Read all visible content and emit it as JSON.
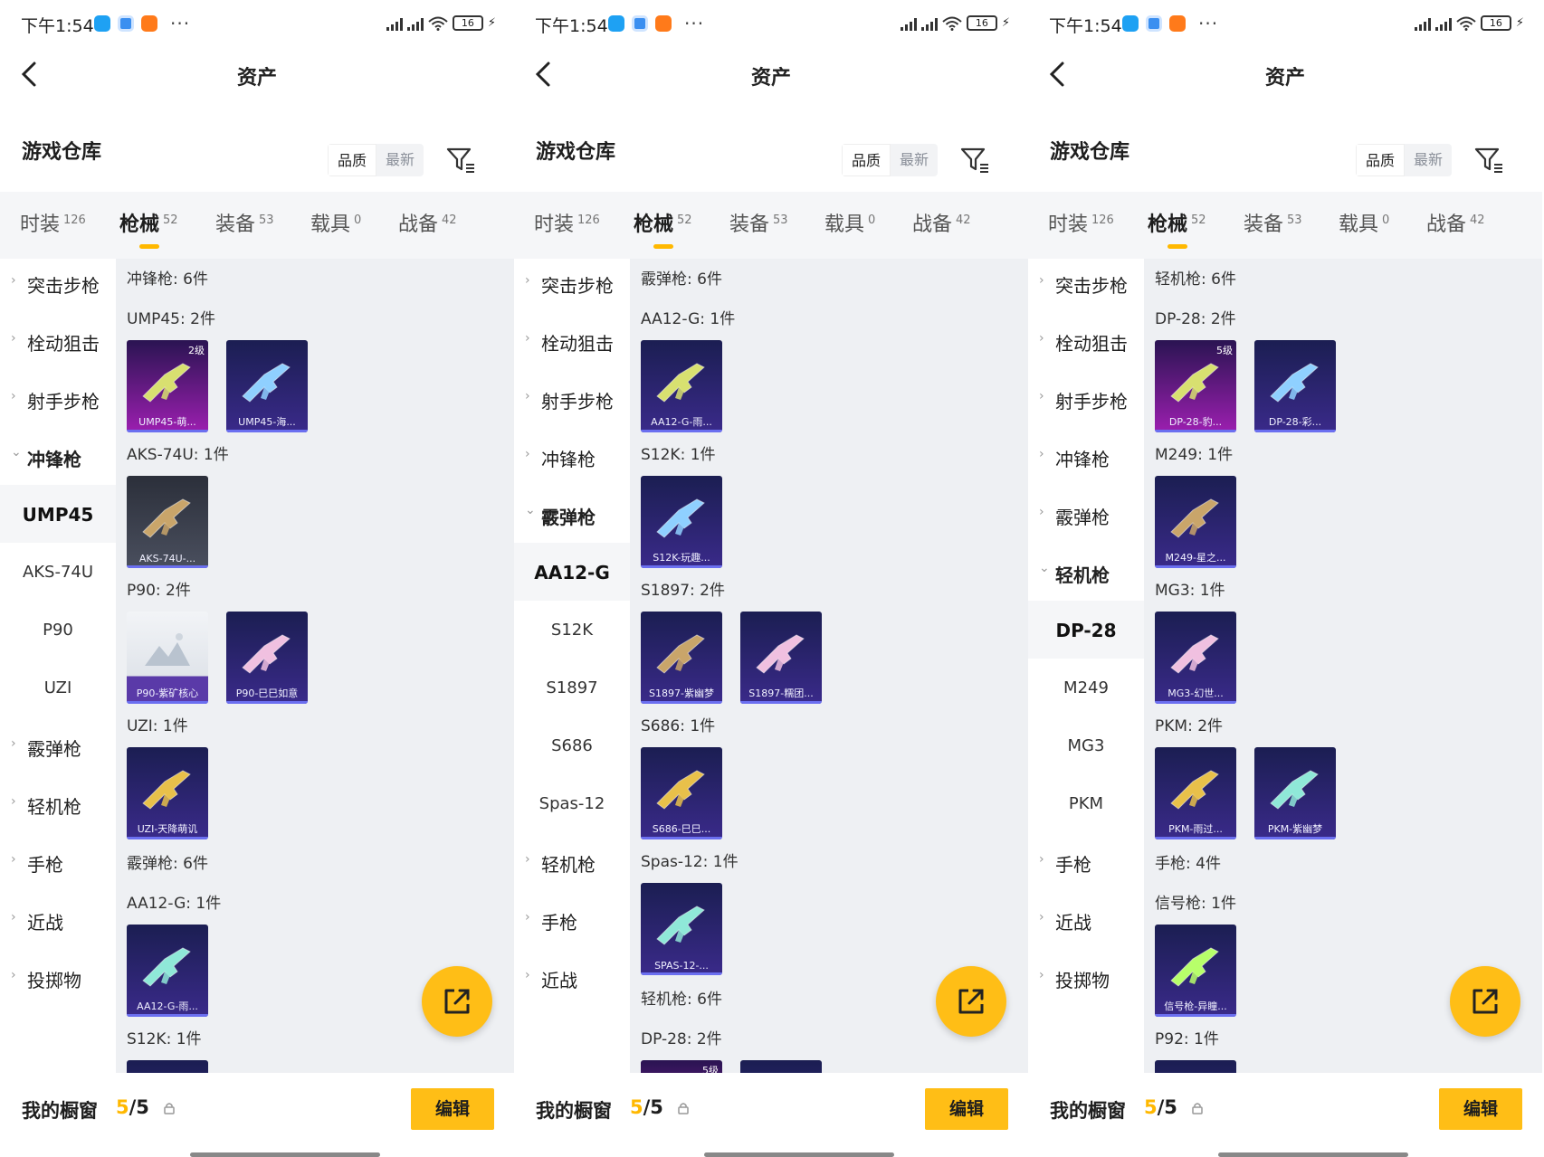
{
  "panels": [
    {
      "status": {
        "time": "下午1:54",
        "battery": "16"
      },
      "nav": {
        "title": "资产"
      },
      "header": {
        "title": "游戏仓库",
        "sort": [
          "品质",
          "最新"
        ]
      },
      "tabs": [
        {
          "label": "时装",
          "count": "126"
        },
        {
          "label": "枪械",
          "count": "52"
        },
        {
          "label": "装备",
          "count": "53"
        },
        {
          "label": "载具",
          "count": "0"
        },
        {
          "label": "战备",
          "count": "42"
        }
      ],
      "side": [
        "突击步枪",
        "栓动狙击",
        "射手步枪",
        "冲锋枪",
        "UMP45",
        "AKS-74U",
        "P90",
        "UZI",
        "霰弹枪",
        "轻机枪",
        "手枪",
        "近战",
        "投掷物"
      ],
      "content": {
        "section": "冲锋枪: 6件",
        "groups": [
          {
            "title": "UMP45: 2件",
            "items": [
              {
                "name": "UMP45-萌...",
                "level": "2级"
              },
              {
                "name": "UMP45-海...",
                "level": ""
              }
            ]
          },
          {
            "title": "AKS-74U: 1件",
            "items": [
              {
                "name": "AKS-74U-...",
                "level": ""
              }
            ]
          },
          {
            "title": "P90: 2件",
            "items": [
              {
                "name": "P90-紫矿核心",
                "level": ""
              },
              {
                "name": "P90-巳巳如意",
                "level": ""
              }
            ]
          },
          {
            "title": "UZI: 1件",
            "items": [
              {
                "name": "UZI-天降萌讥",
                "level": ""
              }
            ]
          }
        ],
        "section2": "霰弹枪: 6件",
        "groups2": [
          {
            "title": "AA12-G: 1件",
            "items": [
              {
                "name": "AA12-G-雨...",
                "level": ""
              }
            ]
          },
          {
            "title": "S12K: 1件",
            "items": []
          }
        ]
      },
      "bottom": {
        "label": "我的橱窗",
        "count_used": "5",
        "count_total": "/5",
        "edit": "编辑"
      }
    },
    {
      "status": {
        "time": "下午1:54",
        "battery": "16"
      },
      "nav": {
        "title": "资产"
      },
      "header": {
        "title": "游戏仓库",
        "sort": [
          "品质",
          "最新"
        ]
      },
      "tabs": [
        {
          "label": "时装",
          "count": "126"
        },
        {
          "label": "枪械",
          "count": "52"
        },
        {
          "label": "装备",
          "count": "53"
        },
        {
          "label": "载具",
          "count": "0"
        },
        {
          "label": "战备",
          "count": "42"
        }
      ],
      "side": [
        "突击步枪",
        "栓动狙击",
        "射手步枪",
        "冲锋枪",
        "霰弹枪",
        "AA12-G",
        "S12K",
        "S1897",
        "S686",
        "Spas-12",
        "轻机枪",
        "手枪",
        "近战"
      ],
      "content": {
        "section": "霰弹枪: 6件",
        "groups": [
          {
            "title": "AA12-G: 1件",
            "items": [
              {
                "name": "AA12-G-雨...",
                "level": ""
              }
            ]
          },
          {
            "title": "S12K: 1件",
            "items": [
              {
                "name": "S12K-玩趣...",
                "level": ""
              }
            ]
          },
          {
            "title": "S1897: 2件",
            "items": [
              {
                "name": "S1897-紫幽梦",
                "level": ""
              },
              {
                "name": "S1897-糯团...",
                "level": ""
              }
            ]
          },
          {
            "title": "S686: 1件",
            "items": [
              {
                "name": "S686-巳巳...",
                "level": ""
              }
            ]
          },
          {
            "title": "Spas-12: 1件",
            "items": [
              {
                "name": "SPAS-12-...",
                "level": ""
              }
            ]
          }
        ],
        "section2": "轻机枪: 6件",
        "groups2": [
          {
            "title": "DP-28: 2件",
            "items": []
          }
        ],
        "peek": [
          {
            "level": "5级"
          },
          {
            "level": ""
          }
        ]
      },
      "bottom": {
        "label": "我的橱窗",
        "count_used": "5",
        "count_total": "/5",
        "edit": "编辑"
      }
    },
    {
      "status": {
        "time": "下午1:54",
        "battery": "16"
      },
      "nav": {
        "title": "资产"
      },
      "header": {
        "title": "游戏仓库",
        "sort": [
          "品质",
          "最新"
        ]
      },
      "tabs": [
        {
          "label": "时装",
          "count": "126"
        },
        {
          "label": "枪械",
          "count": "52"
        },
        {
          "label": "装备",
          "count": "53"
        },
        {
          "label": "载具",
          "count": "0"
        },
        {
          "label": "战备",
          "count": "42"
        }
      ],
      "side": [
        "突击步枪",
        "栓动狙击",
        "射手步枪",
        "冲锋枪",
        "霰弹枪",
        "轻机枪",
        "DP-28",
        "M249",
        "MG3",
        "PKM",
        "手枪",
        "近战",
        "投掷物"
      ],
      "content": {
        "section": "轻机枪: 6件",
        "groups": [
          {
            "title": "DP-28: 2件",
            "items": [
              {
                "name": "DP-28-豹...",
                "level": "5级"
              },
              {
                "name": "DP-28-彩...",
                "level": ""
              }
            ]
          },
          {
            "title": "M249: 1件",
            "items": [
              {
                "name": "M249-星之...",
                "level": ""
              }
            ]
          },
          {
            "title": "MG3: 1件",
            "items": [
              {
                "name": "MG3-幻世...",
                "level": ""
              }
            ]
          },
          {
            "title": "PKM: 2件",
            "items": [
              {
                "name": "PKM-雨过...",
                "level": ""
              },
              {
                "name": "PKM-紫幽梦",
                "level": ""
              }
            ]
          }
        ],
        "section2": "手枪: 4件",
        "groups2": [
          {
            "title": "信号枪: 1件",
            "items": [
              {
                "name": "信号枪-异瞳...",
                "level": ""
              }
            ]
          },
          {
            "title": "P92: 1件",
            "items": []
          }
        ]
      },
      "bottom": {
        "label": "我的橱窗",
        "count_used": "5",
        "count_total": "/5",
        "edit": "编辑"
      }
    }
  ],
  "colors": {
    "accent": "#ffbe16",
    "panel_bg": "#eef0f3"
  },
  "icons": [
    "back-arrow-icon",
    "filter-icon",
    "share-icon",
    "lock-icon",
    "wifi-icon",
    "signal-icon",
    "battery-icon"
  ]
}
